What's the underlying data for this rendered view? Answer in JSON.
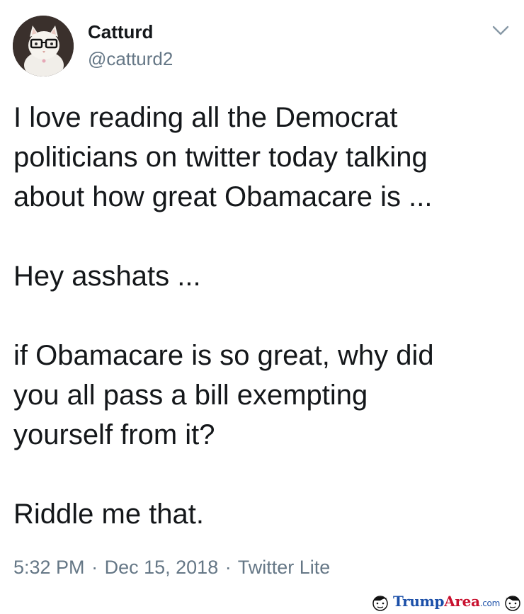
{
  "tweet": {
    "display_name": "Catturd",
    "handle": "@catturd2",
    "paragraphs": [
      "I love reading all the Democrat\npoliticians on twitter today talking\nabout how great Obamacare is ...",
      "Hey asshats ...",
      "if Obamacare is so great, why did\nyou all pass a bill exempting\nyourself from it?",
      "Riddle me that."
    ],
    "time": "5:32 PM",
    "date": "Dec 15, 2018",
    "source": "Twitter Lite",
    "separator": "·"
  },
  "watermark": {
    "brand": "Trump",
    "brand_accent": "Area",
    "tld": ".com"
  },
  "icons": {
    "avatar": "cat-with-glasses-avatar",
    "menu": "chevron-down-icon"
  },
  "colors": {
    "text": "#14171a",
    "secondary": "#657786",
    "background": "#ffffff",
    "watermark_blue": "#1b4fa8",
    "watermark_red": "#c8102e"
  }
}
